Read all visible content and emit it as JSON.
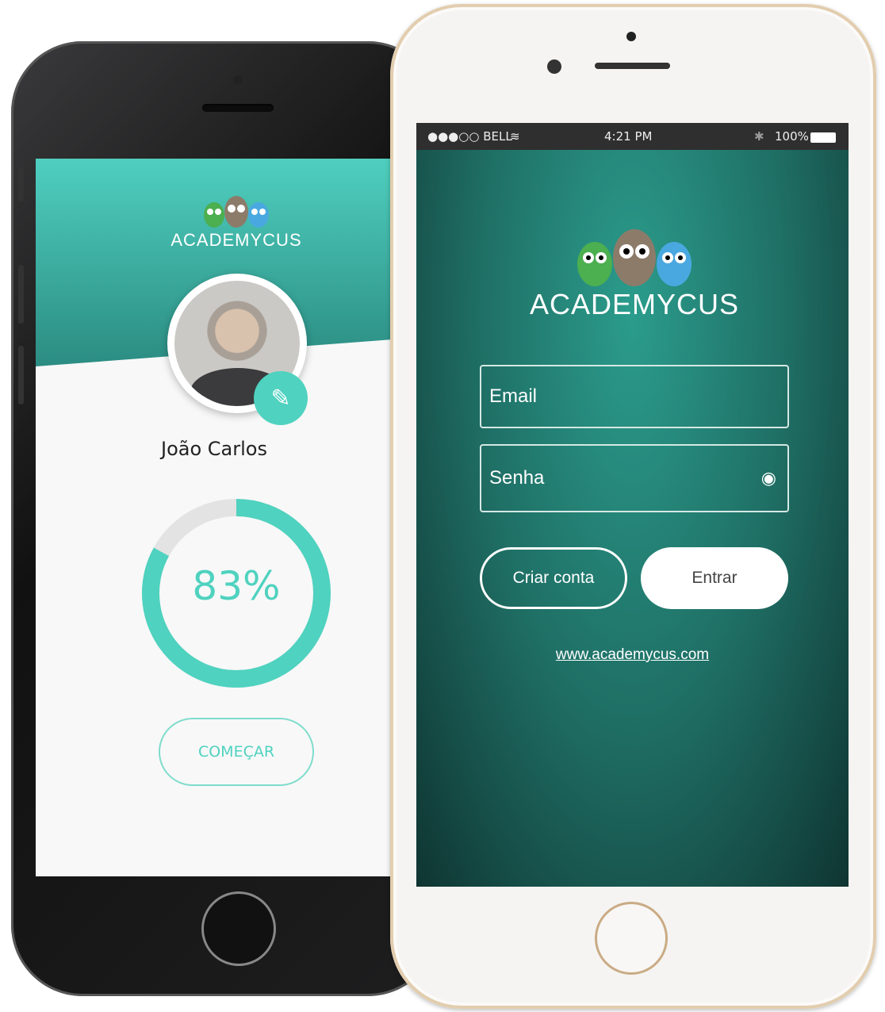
{
  "profile_screen": {
    "logo_text": "ACADEMYCUS",
    "user_name": "João Carlos",
    "progress_percent": 83,
    "progress_label": "83%",
    "start_button": "COMEÇAR",
    "accent_color": "#4fd2bf"
  },
  "login_screen": {
    "status_bar": {
      "carrier": "●●●○○ BELL",
      "time": "4:21 PM",
      "battery": "100%"
    },
    "logo_text": "ACADEMYCUS",
    "email_placeholder": "Email",
    "password_placeholder": "Senha",
    "create_account_button": "Criar conta",
    "login_button": "Entrar",
    "website_link": "www.academycus.com"
  }
}
